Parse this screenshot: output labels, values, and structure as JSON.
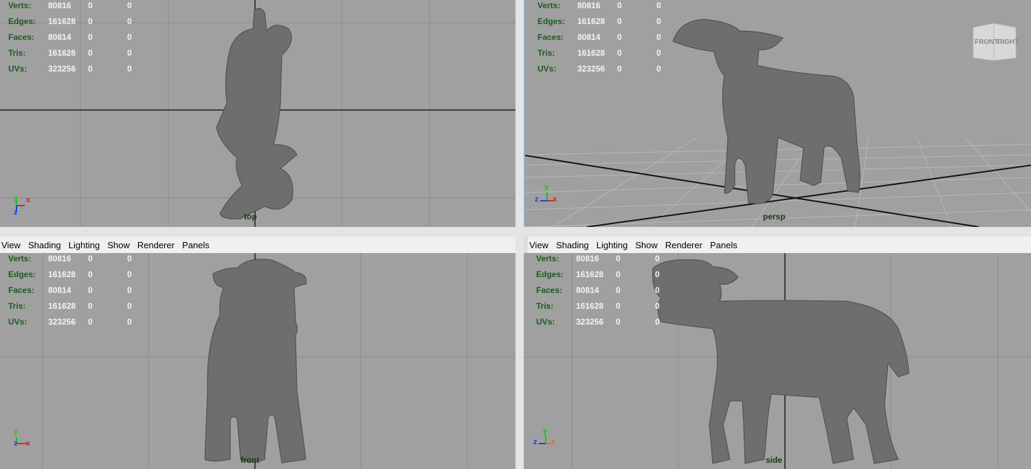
{
  "menu": [
    "View",
    "Shading",
    "Lighting",
    "Show",
    "Renderer",
    "Panels"
  ],
  "hud": [
    {
      "label": "Verts:",
      "v1": "80816",
      "v2": "0",
      "v3": "0"
    },
    {
      "label": "Edges:",
      "v1": "161628",
      "v2": "0",
      "v3": "0"
    },
    {
      "label": "Faces:",
      "v1": "80814",
      "v2": "0",
      "v3": "0"
    },
    {
      "label": "Tris:",
      "v1": "161628",
      "v2": "0",
      "v3": "0"
    },
    {
      "label": "UVs:",
      "v1": "323256",
      "v2": "0",
      "v3": "0"
    }
  ],
  "viewports": {
    "top": {
      "camera": "top",
      "axis": [
        "y",
        "x",
        "z"
      ]
    },
    "persp": {
      "camera": "persp",
      "axis": [
        "y",
        "z",
        "x"
      ],
      "viewcube": [
        "FRONT",
        "RIGHT"
      ]
    },
    "front": {
      "camera": "front",
      "axis": [
        "y",
        "z",
        "x"
      ]
    },
    "side": {
      "camera": "side",
      "axis": [
        "y",
        "z",
        "x"
      ]
    }
  },
  "colors": {
    "viewport_bg": "#a0a0a0",
    "grid": "#8a8a8a",
    "model": "#6e6e6e",
    "hud_label": "#1e5a1e",
    "hud_value": "#f4f4f4",
    "axis_x": "#e02020",
    "axis_y": "#20c020",
    "axis_z": "#2040e0"
  }
}
